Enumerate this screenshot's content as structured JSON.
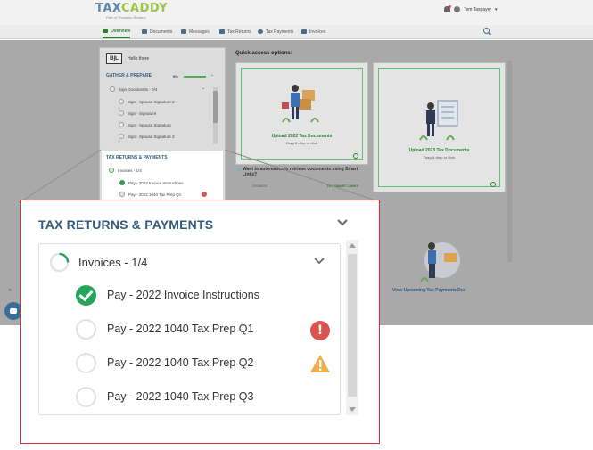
{
  "app": {
    "logo_text_1": "TAX",
    "logo_text_2": "CADDY",
    "logo_sub": "Part of Thomson Reuters",
    "user_name": "Tom Taxpayer"
  },
  "nav": {
    "items": [
      {
        "label": "Overview",
        "icon": "home-icon",
        "active": true
      },
      {
        "label": "Documents",
        "icon": "documents-icon"
      },
      {
        "label": "Messages",
        "icon": "messages-icon"
      },
      {
        "label": "Tax Returns",
        "icon": "tax-returns-icon"
      },
      {
        "label": "Tax Payments",
        "icon": "dollar-icon"
      },
      {
        "label": "Invoices",
        "icon": "invoices-icon"
      }
    ]
  },
  "sidebar": {
    "logo": "B|L",
    "greeting": "Hello there",
    "gather_title": "GATHER & PREPARE",
    "gather_pct": "0%",
    "sign_group": "Sign Documents - 0/4",
    "sign_items": [
      "Sign - Spouse Signature 2",
      "Sign - Signature",
      "Sign - Spouse Signature",
      "Sign - Spouse Signature 3"
    ],
    "tax_title": "TAX RETURNS & PAYMENTS",
    "invoice_group": "Invoices - 1/4",
    "invoice_items": [
      "Pay - 2022 Invoice Instructions",
      "Pay - 2022 1040 Tax Prep Q1"
    ]
  },
  "quick_access": {
    "title": "Quick access options:",
    "card1_label": "Upload 2022 Tax Documents",
    "card1_sub": "Drag & drop or click",
    "card2_label": "Upload 2023 Tax Documents",
    "card2_sub": "Drag & drop or click",
    "smart_question": "Want to automatically retrieve documents using Smart Links?",
    "dismiss": "DISMISS",
    "try_smart": "TRY SMART LINKS",
    "card3_label": "View Upcoming Tax Payments Due"
  },
  "zoom": {
    "title": "TAX RETURNS & PAYMENTS",
    "group_label": "Invoices - 1/4",
    "items": [
      {
        "label": "Pay - 2022 Invoice Instructions",
        "status": "done"
      },
      {
        "label": "Pay - 2022 1040 Tax Prep Q1",
        "status": "error"
      },
      {
        "label": "Pay - 2022 1040 Tax Prep Q2",
        "status": "warning"
      },
      {
        "label": "Pay - 2022 1040 Tax Prep Q3",
        "status": "pending"
      }
    ],
    "error_glyph": "!",
    "colors": {
      "title": "#335a7c",
      "border": "#d32f2f",
      "done": "#27a35a",
      "error": "#d9534f",
      "warning": "#f0ad4e"
    }
  }
}
